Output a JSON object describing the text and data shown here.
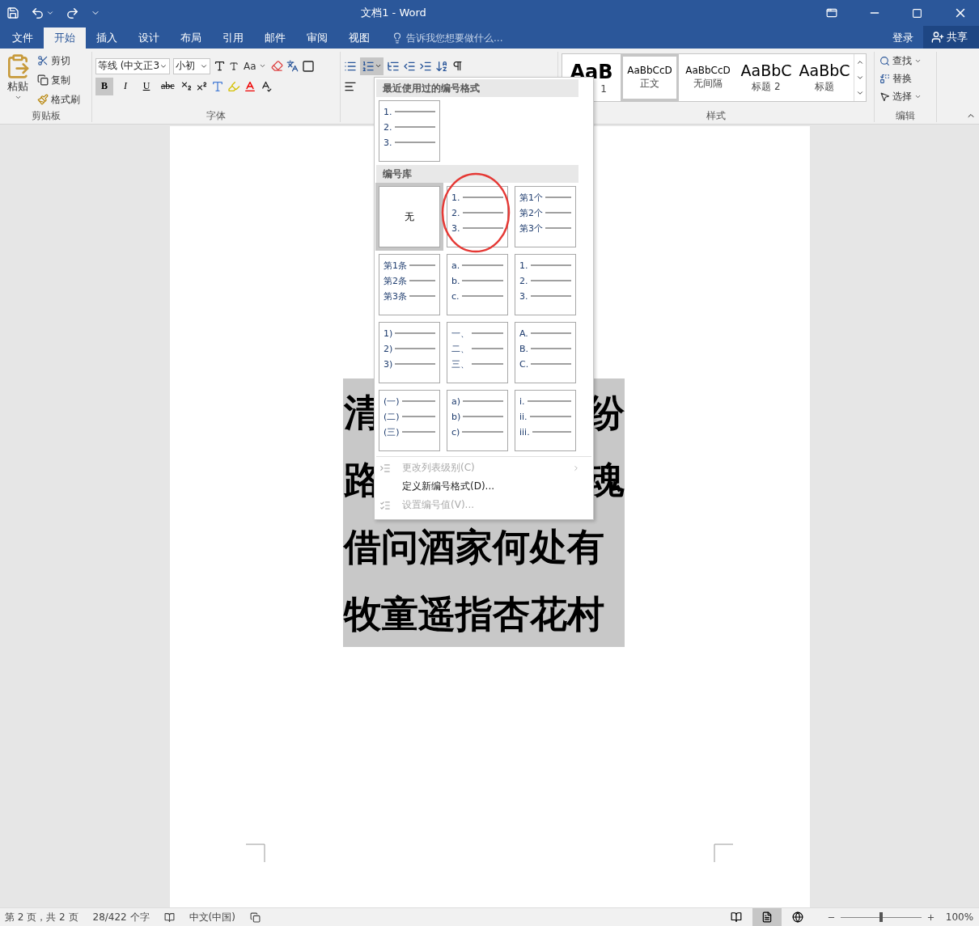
{
  "title_bar": {
    "title": "文档1 - Word"
  },
  "menu_tabs": [
    {
      "label": "文件",
      "selected": false
    },
    {
      "label": "开始",
      "selected": true
    },
    {
      "label": "插入",
      "selected": false
    },
    {
      "label": "设计",
      "selected": false
    },
    {
      "label": "布局",
      "selected": false
    },
    {
      "label": "引用",
      "selected": false
    },
    {
      "label": "邮件",
      "selected": false
    },
    {
      "label": "审阅",
      "selected": false
    },
    {
      "label": "视图",
      "selected": false
    }
  ],
  "tell_me": {
    "placeholder": "告诉我您想要做什么..."
  },
  "account": {
    "sign_in": "登录",
    "share": "共享"
  },
  "clipboard": {
    "paste": "粘贴",
    "cut": "剪切",
    "copy": "复制",
    "format_painter": "格式刷",
    "group_label": "剪贴板"
  },
  "font": {
    "font_name": "等线 (中文正3",
    "font_size": "小初",
    "case_button": "Aa",
    "group_label": "字体",
    "format_buttons": [
      {
        "label": "B",
        "kind": "bold",
        "on": true
      },
      {
        "label": "I",
        "kind": "italic",
        "on": false
      },
      {
        "label": "U",
        "kind": "underline",
        "on": false
      },
      {
        "label": "abc",
        "kind": "strike",
        "on": false
      }
    ]
  },
  "paragraph": {
    "numbering_open": true
  },
  "styles": {
    "group_label": "样式",
    "items": [
      {
        "preview": "AaB",
        "name": "1",
        "kind": "heading",
        "selected": false
      },
      {
        "preview": "AaBbCcD",
        "name": "正文",
        "kind": "body",
        "selected": true
      },
      {
        "preview": "AaBbCcD",
        "name": "无间隔",
        "kind": "body",
        "selected": false
      },
      {
        "preview": "AaBbC",
        "name": "标题 2",
        "kind": "subheading",
        "selected": false
      },
      {
        "preview": "AaBbC",
        "name": "标题",
        "kind": "subheading",
        "selected": false
      }
    ]
  },
  "editing": {
    "find": "查找",
    "replace": "替换",
    "select": "选择",
    "group_label": "编辑"
  },
  "document": {
    "lines": [
      {
        "kind": "split",
        "start": "清",
        "end": "纷"
      },
      {
        "kind": "split",
        "start": "路",
        "end": "魂"
      },
      {
        "kind": "full",
        "text": "借问酒家何处有"
      },
      {
        "kind": "full",
        "text": "牧童遥指杏花村"
      }
    ]
  },
  "numbering_menu": {
    "recent_header": "最近使用过的编号格式",
    "recent": [
      {
        "kind": "list",
        "markers": [
          "1.",
          "2.",
          "3."
        ],
        "selected": false,
        "circled": false
      }
    ],
    "library_header": "编号库",
    "library": [
      {
        "kind": "none",
        "label": "无",
        "selected": true,
        "circled": false
      },
      {
        "kind": "list",
        "markers": [
          "1.",
          "2.",
          "3."
        ],
        "selected": false,
        "circled": true
      },
      {
        "kind": "list",
        "markers": [
          "第1个",
          "第2个",
          "第3个"
        ],
        "selected": false,
        "circled": false
      },
      {
        "kind": "list",
        "markers": [
          "第1条",
          "第2条",
          "第3条"
        ],
        "selected": false,
        "circled": false
      },
      {
        "kind": "list",
        "markers": [
          "a.",
          "b.",
          "c."
        ],
        "selected": false,
        "circled": false
      },
      {
        "kind": "list",
        "markers": [
          "1.",
          "2.",
          "3."
        ],
        "selected": false,
        "circled": false
      },
      {
        "kind": "list",
        "markers": [
          "1)",
          "2)",
          "3)"
        ],
        "selected": false,
        "circled": false
      },
      {
        "kind": "list",
        "markers": [
          "一、",
          "二、",
          "三、"
        ],
        "selected": false,
        "circled": false
      },
      {
        "kind": "list",
        "markers": [
          "A.",
          "B.",
          "C."
        ],
        "selected": false,
        "circled": false
      },
      {
        "kind": "list",
        "markers": [
          "(一)",
          "(二)",
          "(三)"
        ],
        "selected": false,
        "circled": false
      },
      {
        "kind": "list",
        "markers": [
          "a)",
          "b)",
          "c)"
        ],
        "selected": false,
        "circled": false
      },
      {
        "kind": "list",
        "markers": [
          "i.",
          "ii.",
          "iii."
        ],
        "selected": false,
        "circled": false
      }
    ],
    "commands": [
      {
        "label": "更改列表级别(C)",
        "kind": "level",
        "disabled": true
      },
      {
        "label": "定义新编号格式(D)...",
        "kind": "define",
        "disabled": false
      },
      {
        "label": "设置编号值(V)...",
        "kind": "value",
        "disabled": true
      }
    ]
  },
  "status_bar": {
    "page": "第 2 页，共 2 页",
    "words": "28/422 个字",
    "language": "中文(中国)",
    "views": [
      {
        "kind": "read",
        "selected": false
      },
      {
        "kind": "print",
        "selected": true
      },
      {
        "kind": "web",
        "selected": false
      }
    ],
    "zoom": {
      "level": 0.5,
      "reading": "100%"
    }
  }
}
